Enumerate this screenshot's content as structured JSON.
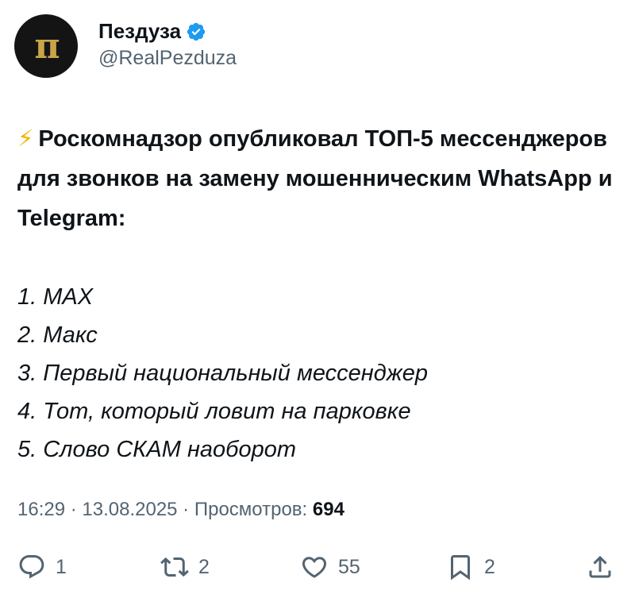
{
  "author": {
    "avatar_glyph": "п",
    "display_name": "Пездуза",
    "handle": "@RealPezduza",
    "verified_color": "#1d9bf0"
  },
  "tweet": {
    "bolt_glyph": "⚡",
    "headline": "Роскомнадзор опубликовал ТОП-5 мессенджеров для звонков на замену мошенническим WhatsApp и Telegram:",
    "list": [
      "1. MAX",
      "2. Макс",
      "3. Первый национальный мессенджер",
      "4. Тот, который ловит на парковке",
      "5. Слово СКАМ наоборот"
    ]
  },
  "meta": {
    "time": "16:29",
    "separator": " · ",
    "date": "13.08.2025",
    "views_label": "Просмотров: ",
    "views_count": "694"
  },
  "actions": {
    "replies": "1",
    "retweets": "2",
    "likes": "55",
    "bookmarks": "2"
  },
  "icons": [
    "verified-icon",
    "reply-icon",
    "retweet-icon",
    "like-icon",
    "bookmark-icon",
    "share-icon"
  ]
}
